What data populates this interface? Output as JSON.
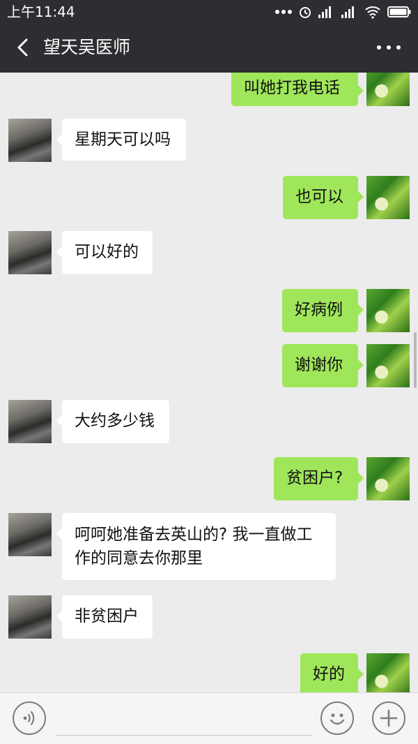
{
  "status_bar": {
    "time": "上午11:44"
  },
  "header": {
    "title": "望天吴医师"
  },
  "messages": [
    {
      "side": "me",
      "text": "叫她打我电话"
    },
    {
      "side": "them",
      "text": "星期天可以吗"
    },
    {
      "side": "me",
      "text": "也可以"
    },
    {
      "side": "them",
      "text": "可以好的"
    },
    {
      "side": "me",
      "text": "好病例"
    },
    {
      "side": "me",
      "text": "谢谢你"
    },
    {
      "side": "them",
      "text": "大约多少钱"
    },
    {
      "side": "me",
      "text": "贫困户?"
    },
    {
      "side": "them",
      "line1": "呵呵她准备去英山的? 我一直做工",
      "line2": "作的同意去你那里"
    },
    {
      "side": "them",
      "text": "非贫困户"
    },
    {
      "side": "me",
      "text": "好的"
    }
  ],
  "colors": {
    "bar": "#2e2e32",
    "sent_bubble": "#9fe65a",
    "received_bubble": "#ffffff",
    "background": "#ececec"
  },
  "icons": {
    "back": "chevron-left-icon",
    "more": "more-dots-icon",
    "voice": "voice-icon",
    "emoji": "emoji-icon",
    "plus": "plus-icon"
  }
}
